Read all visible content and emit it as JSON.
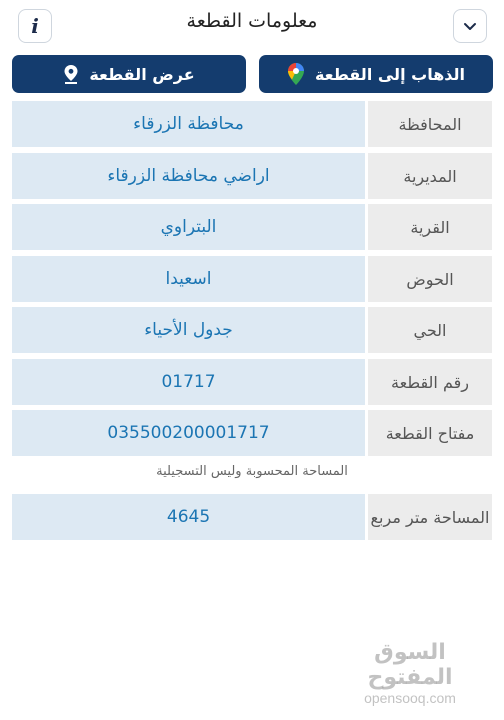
{
  "header": {
    "title": "معلومات القطعة",
    "info_label": "i"
  },
  "actions": {
    "goto_label": "الذهاب إلى القطعة",
    "show_label": "عرض القطعة"
  },
  "rows": [
    {
      "label": "المحافظة",
      "value": "محافظة الزرقاء"
    },
    {
      "label": "المديرية",
      "value": "اراضي محافظة الزرقاء"
    },
    {
      "label": "القرية",
      "value": "البتراوي"
    },
    {
      "label": "الحوض",
      "value": "اسعيدا"
    },
    {
      "label": "الحي",
      "value": "جدول الأحياء"
    },
    {
      "label": "رقم القطعة",
      "value": "01717"
    },
    {
      "label": "مفتاح القطعة",
      "value": "035500200001717"
    }
  ],
  "area_note": "المساحة المحسوبة وليس التسجيلية",
  "area_row": {
    "label": "المساحة متر مربع",
    "value": "4645"
  },
  "watermark": {
    "arabic": "السوق المفتوح",
    "latin": "opensooq.com"
  },
  "colors": {
    "accent": "#143c6e",
    "value_text": "#1b75b3",
    "value_bg": "#dde9f3",
    "label_bg": "#ececec"
  }
}
